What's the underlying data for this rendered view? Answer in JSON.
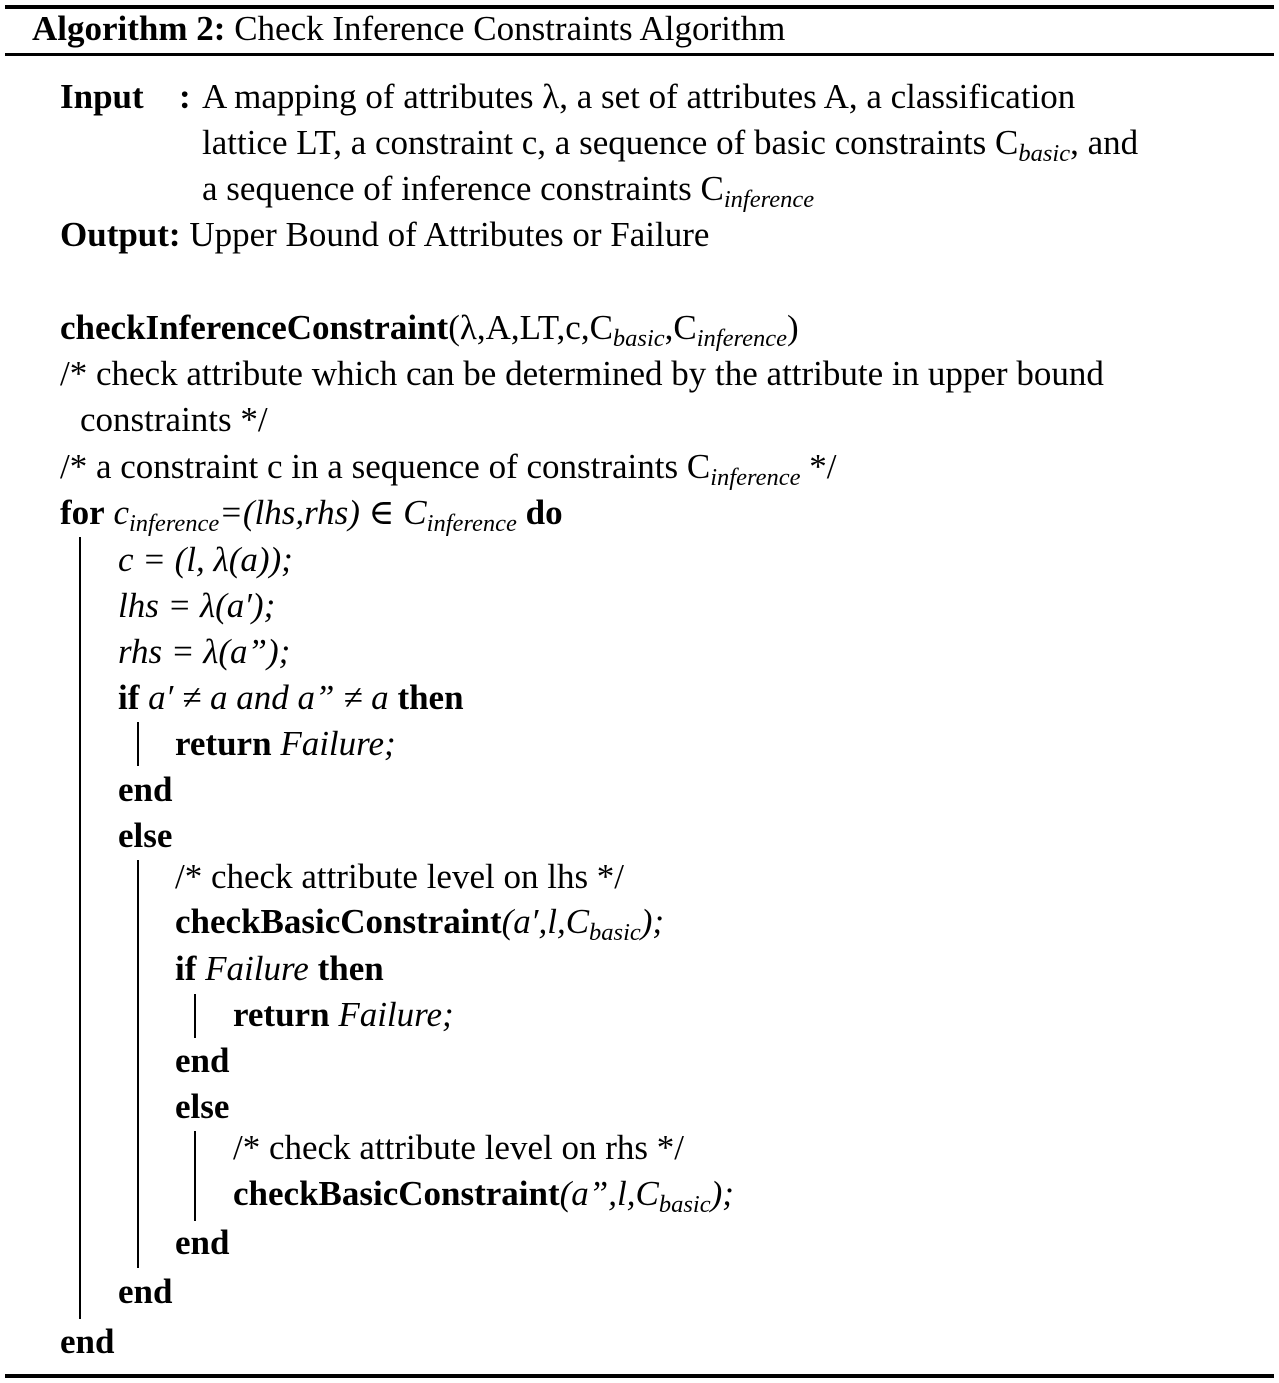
{
  "algorithm": {
    "label": "Algorithm 2:",
    "title": "Check Inference Constraints Algorithm"
  },
  "io": {
    "input_label": "Input",
    "input_colon": ":",
    "input_line1": "A mapping of attributes λ, a set of attributes A, a classification",
    "input_line2": "lattice LT, a constraint c, a sequence of basic constraints C_basic, and",
    "input_line3": "a sequence of inference constraints C_inference",
    "output_label": "Output:",
    "output_text": "Upper Bound of Attributes or Failure"
  },
  "code": {
    "fn_name": "checkInferenceConstraint",
    "fn_args": "(λ,A,LT,c,C_basic,C_inference)",
    "comment1_line1": "/* check attribute which can be determined by the attribute in upper bound",
    "comment1_line2": "constraints */",
    "comment2": "/* a constraint c in a sequence of constraints C_inference */",
    "kw_for": "for",
    "for_cond": "c_inference=(lhs,rhs) ∈ C_inference",
    "kw_do": "do",
    "stmt_c": "c = (l, λ(a));",
    "stmt_lhs": "lhs = λ(a′);",
    "stmt_rhs": "rhs = λ(a”);",
    "kw_if": "if",
    "if_cond": "a′ ≠ a and a” ≠ a",
    "kw_then": "then",
    "kw_return": "return",
    "ret_val": "Failure;",
    "kw_end": "end",
    "kw_else": "else",
    "comment3": "/* check attribute level on lhs */",
    "call_basic_fn": "checkBasicConstraint",
    "call_basic_args1": "(a′,l,C_basic);",
    "if2_cond": "Failure",
    "comment4": "/* check attribute level on rhs */",
    "call_basic_args2": "(a”,l,C_basic);"
  }
}
